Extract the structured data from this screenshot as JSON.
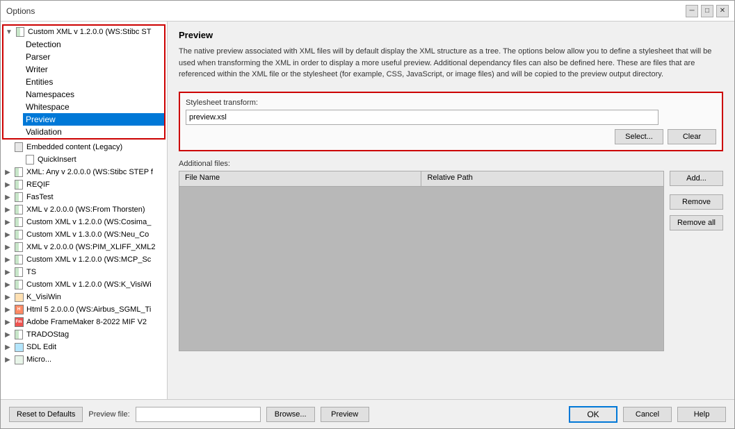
{
  "window": {
    "title": "Options"
  },
  "titlebar": {
    "title": "Options",
    "minimize_label": "─",
    "restore_label": "□",
    "close_label": "✕"
  },
  "sidebar": {
    "top_item": {
      "label": "Custom XML v 1.2.0.0 (WS:Stibc ST",
      "expanded": true,
      "sub_items": [
        {
          "label": "Detection",
          "active": false
        },
        {
          "label": "Parser",
          "active": false
        },
        {
          "label": "Writer",
          "active": false
        },
        {
          "label": "Entities",
          "active": false
        },
        {
          "label": "Namespaces",
          "active": false
        },
        {
          "label": "Whitespace",
          "active": false
        },
        {
          "label": "Preview",
          "active": true
        },
        {
          "label": "Validation",
          "active": false
        }
      ]
    },
    "other_items": [
      {
        "label": "Embedded content (Legacy)",
        "has_expand": false,
        "indent": 0
      },
      {
        "label": "QuickInsert",
        "has_expand": false,
        "indent": 1
      },
      {
        "label": "XML: Any v 2.0.0.0 (WS:Stibc STEP f",
        "has_expand": true,
        "indent": 0,
        "icon": "xml"
      },
      {
        "label": "REQIF",
        "has_expand": true,
        "indent": 0,
        "icon": "xml"
      },
      {
        "label": "FasTest",
        "has_expand": true,
        "indent": 0,
        "icon": "xml"
      },
      {
        "label": "XML v 2.0.0.0 (WS:From Thorsten)",
        "has_expand": true,
        "indent": 0,
        "icon": "xml"
      },
      {
        "label": "Custom XML v 1.2.0.0 (WS:Cosima_",
        "has_expand": true,
        "indent": 0,
        "icon": "xml"
      },
      {
        "label": "Custom XML v 1.3.0.0 (WS:Neu_Co",
        "has_expand": true,
        "indent": 0,
        "icon": "xml"
      },
      {
        "label": "XML v 2.0.0.0 (WS:PIM_XLIFF_XML2",
        "has_expand": true,
        "indent": 0,
        "icon": "xml"
      },
      {
        "label": "Custom XML v 1.2.0.0 (WS:MCP_Sc",
        "has_expand": true,
        "indent": 0,
        "icon": "xml"
      },
      {
        "label": "TS",
        "has_expand": true,
        "indent": 0,
        "icon": "xml"
      },
      {
        "label": "Custom XML v 1.2.0.0 (WS:K_VisiWi",
        "has_expand": true,
        "indent": 0,
        "icon": "xml"
      },
      {
        "label": "K_VisiWin",
        "has_expand": true,
        "indent": 0,
        "icon": "folder"
      },
      {
        "label": "Html 5 2.0.0.0 (WS:Airbus_SGML_Ti",
        "has_expand": true,
        "indent": 0,
        "icon": "html"
      },
      {
        "label": "Adobe FrameMaker 8-2022 MIF V2",
        "has_expand": true,
        "indent": 0,
        "icon": "fm"
      },
      {
        "label": "TRADOStag",
        "has_expand": true,
        "indent": 0,
        "icon": "xml"
      },
      {
        "label": "SDL Edit",
        "has_expand": true,
        "indent": 0,
        "icon": "edit"
      },
      {
        "label": "Micro...",
        "has_expand": true,
        "indent": 0,
        "icon": "xml"
      }
    ]
  },
  "right": {
    "section_title": "Preview",
    "description": "The native preview associated with XML files will by default display the XML structure as a tree.  The options below allow you to define a stylesheet that will be used when transforming the XML in order to display a more useful preview.  Additional dependancy files can also be defined here.  These are files that are referenced within the XML file or the stylesheet (for example, CSS, JavaScript, or image files) and will be copied to the preview output directory.",
    "stylesheet_label": "Stylesheet transform:",
    "stylesheet_value": "preview.xsl",
    "select_btn": "Select...",
    "clear_btn": "Clear",
    "additional_files_label": "Additional files:",
    "table_col1": "File Name",
    "table_col2": "Relative Path",
    "add_btn": "Add...",
    "remove_btn": "Remove",
    "remove_all_btn": "Remove all"
  },
  "bottom_bar": {
    "preview_file_label": "Preview file:",
    "preview_file_value": "",
    "browse_btn": "Browse...",
    "preview_btn": "Preview",
    "ok_btn": "OK",
    "cancel_btn": "Cancel",
    "help_btn": "Help",
    "reset_btn": "Reset to Defaults"
  }
}
